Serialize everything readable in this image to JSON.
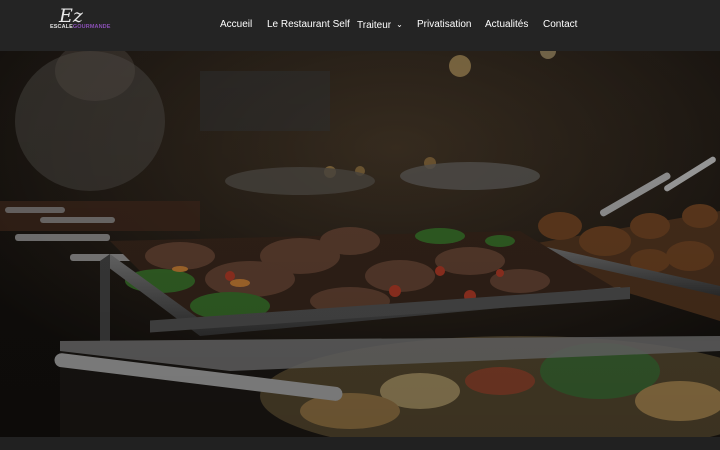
{
  "logo": {
    "script": "Ez",
    "text_part1": "ESCALE",
    "text_part2": "GOURMANDE",
    "icon": "brand-logo"
  },
  "nav": {
    "items": [
      {
        "label": "Accueil"
      },
      {
        "label": "Le Restaurant Self"
      },
      {
        "label": "Traiteur",
        "dropdown": true
      },
      {
        "label": "Privatisation"
      },
      {
        "label": "Actualités"
      },
      {
        "label": "Contact"
      }
    ],
    "dropdown_icon": "chevron-down-icon"
  },
  "hero": {
    "image_subject": "buffet-chafing-dishes-photo"
  },
  "colors": {
    "header_bg": "#242424",
    "nav_text": "#ffffff",
    "logo_accent": "#8a4fb5"
  }
}
